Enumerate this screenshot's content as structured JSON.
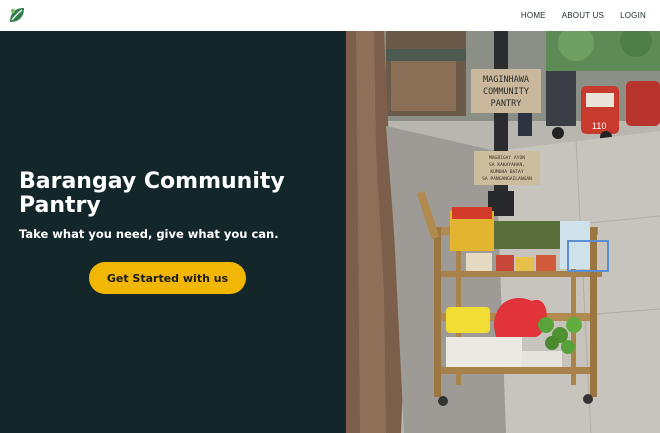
{
  "nav": {
    "logo_icon": "leaf-logo-icon",
    "links": [
      {
        "label": "HOME"
      },
      {
        "label": "ABOUT US"
      },
      {
        "label": "LOGIN"
      }
    ]
  },
  "hero": {
    "title": "Barangay Community Pantry",
    "subtitle": "Take what you need, give what you can.",
    "cta_label": "Get Started with us"
  },
  "photo": {
    "sign_top": [
      "MAGINHAWA",
      "COMMUNITY",
      "PANTRY"
    ],
    "sign_small": [
      "MAGBIGAY AYON",
      "SA KAKAYAHAN,",
      "KUMUHA BATAY",
      "SA PANGANGAILANGAN"
    ]
  },
  "colors": {
    "hero_bg": "#13272a",
    "cta_bg": "#f2b705",
    "logo_green": "#2f7d4a"
  }
}
